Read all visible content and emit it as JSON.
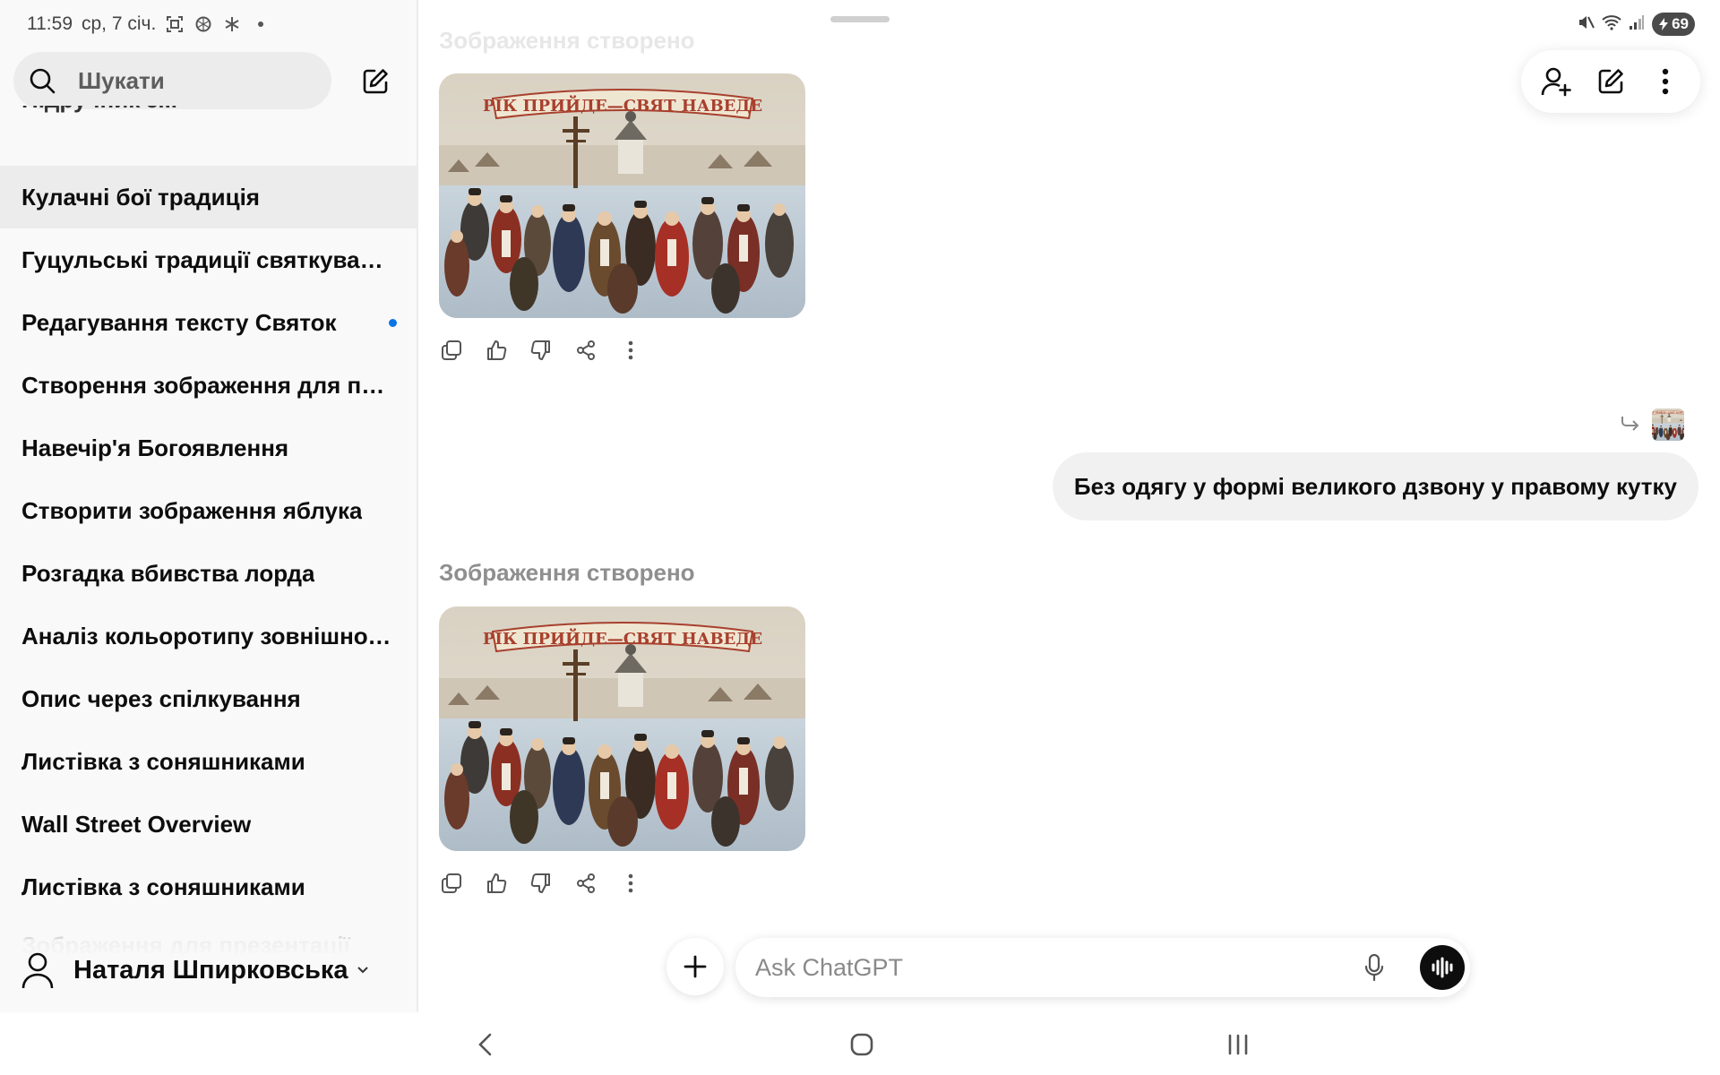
{
  "status_bar": {
    "time": "11:59",
    "date": "ср, 7 січ.",
    "battery": "69",
    "left_icons": [
      "screenshot-icon",
      "openai-icon",
      "snowflake-icon",
      "dot-icon"
    ],
    "right_icons": [
      "mute-icon",
      "wifi-icon",
      "signal-icon",
      "battery-icon"
    ]
  },
  "sidebar": {
    "search_placeholder": "Шукати",
    "cut_item": "Підручник з...",
    "items": [
      {
        "label": "Кулачні бої традиція",
        "active": true
      },
      {
        "label": "Гуцульські традиції святкування"
      },
      {
        "label": "Редагування тексту Святок",
        "unread": true
      },
      {
        "label": "Створення зображення для пре..."
      },
      {
        "label": "Навечір'я Богоявлення"
      },
      {
        "label": "Створити зображення яблука"
      },
      {
        "label": "Розгадка вбивства лорда"
      },
      {
        "label": "Аналіз кольоротипу зовнішності"
      },
      {
        "label": "Опис через спілкування"
      },
      {
        "label": "Листівка з соняшниками"
      },
      {
        "label": "Wall Street Overview"
      },
      {
        "label": "Листівка з соняшниками"
      }
    ],
    "faded_item": "Зображення для презентації",
    "user_name": "Наталя Шпирковська"
  },
  "conversation": {
    "ghost_label": "Зображення створено",
    "image_banner": "РІК ПРИЙДЕ—СВЯТ НАВЕДЕ",
    "user_message": "Без одягу у формі великого дзвону у правому кутку",
    "assistant_label": "Зображення створено",
    "action_icons": [
      "copy-icon",
      "thumbs-up-icon",
      "thumbs-down-icon",
      "share-icon",
      "more-vertical-icon"
    ]
  },
  "composer": {
    "placeholder": "Ask ChatGPT"
  },
  "colors": {
    "accent_dot": "#0b74e5",
    "sidebar_bg": "#f9f9f9",
    "active_item_bg": "#ececec",
    "bubble_bg": "#f1f1f1"
  }
}
